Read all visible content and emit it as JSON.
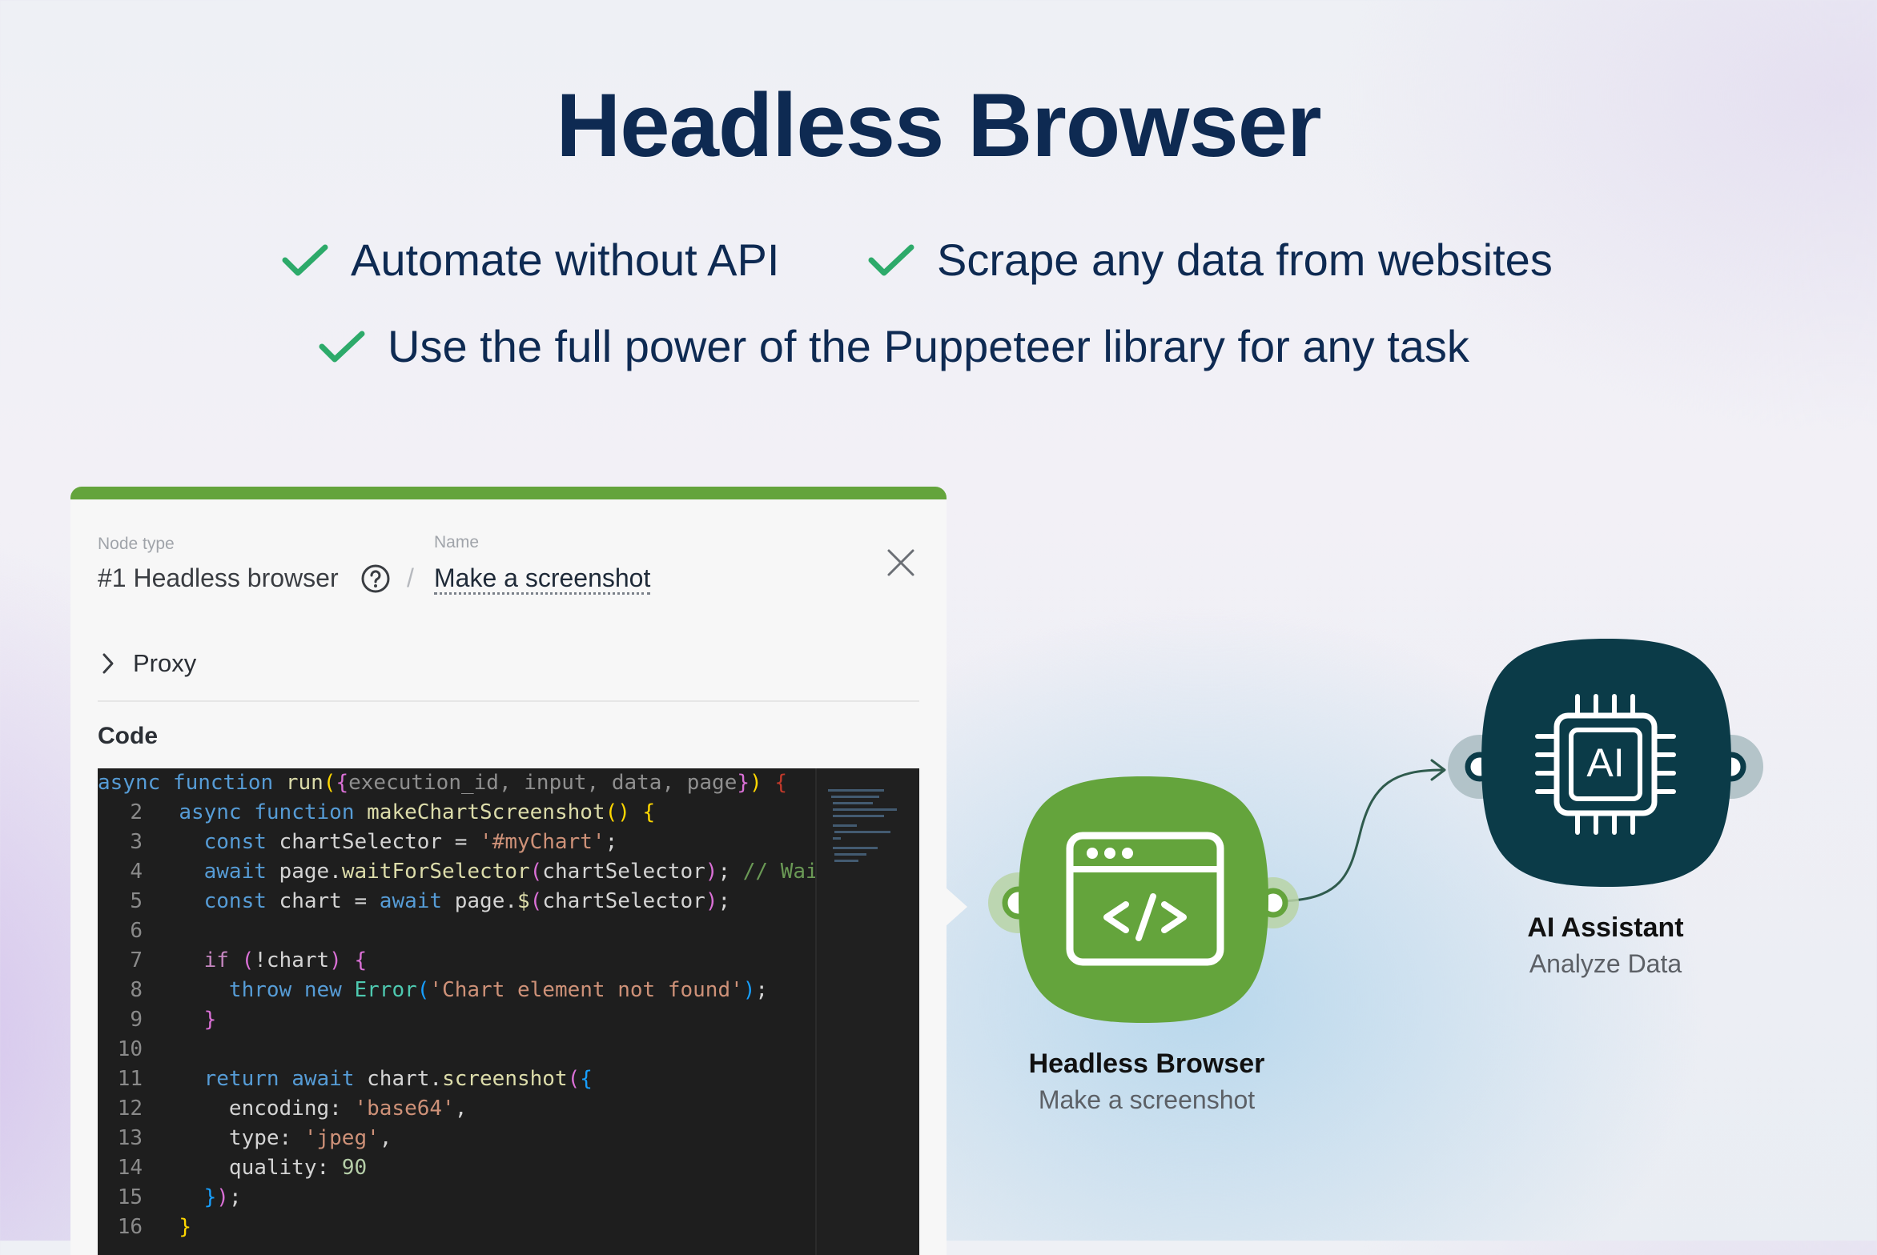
{
  "title": "Headless Browser",
  "features": [
    "Automate without API",
    "Scrape any data from websites",
    "Use the full power of the Puppeteer library for any task"
  ],
  "node_panel": {
    "node_type_label": "Node type",
    "node_type_value": "#1 Headless browser",
    "name_label": "Name",
    "name_value": "Make a screenshot",
    "proxy_label": "Proxy",
    "code_label": "Code",
    "code_lines": [
      "async function run({execution_id, input, data, page}) {",
      "  async function makeChartScreenshot() {",
      "    const chartSelector = '#myChart';",
      "    await page.waitForSelector(chartSelector); // Wait",
      "    const chart = await page.$(chartSelector);",
      "",
      "    if (!chart) {",
      "      throw new Error('Chart element not found');",
      "    }",
      "",
      "    return await chart.screenshot({",
      "      encoding: 'base64',",
      "      type: 'jpeg',",
      "      quality: 90",
      "    });",
      "  }"
    ],
    "line_numbers": [
      "",
      "2",
      "3",
      "4",
      "5",
      "6",
      "7",
      "8",
      "9",
      "10",
      "11",
      "12",
      "13",
      "14",
      "15",
      "16"
    ]
  },
  "flow": {
    "nodes": [
      {
        "title": "Headless Browser",
        "subtitle": "Make a screenshot",
        "icon": "code-window-icon",
        "color": "#64a43c"
      },
      {
        "title": "AI Assistant",
        "subtitle": "Analyze Data",
        "icon": "ai-chip-icon",
        "color": "#0b3b48",
        "chip_text": "AI"
      }
    ]
  },
  "colors": {
    "accent_green": "#64a43c",
    "title_navy": "#0e2a52",
    "check_green": "#2daa6a",
    "ai_teal": "#0b3b48"
  }
}
